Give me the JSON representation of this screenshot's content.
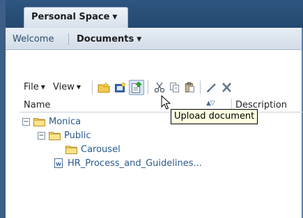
{
  "header": {
    "tab_label": "Personal Space"
  },
  "subnav": {
    "welcome_label": "Welcome",
    "documents_label": "Documents"
  },
  "toolbar": {
    "file_label": "File",
    "view_label": "View",
    "buttons": [
      {
        "icon": "new-folder-icon"
      },
      {
        "icon": "new-item-icon"
      },
      {
        "icon": "upload-document-icon"
      },
      {
        "icon": "cut-icon"
      },
      {
        "icon": "copy-icon"
      },
      {
        "icon": "paste-icon"
      },
      {
        "icon": "edit-icon"
      },
      {
        "icon": "delete-icon"
      }
    ]
  },
  "columns": {
    "name": "Name",
    "description": "Description"
  },
  "tree": [
    {
      "label": "Monica",
      "type": "folder",
      "expanded": true,
      "level": 0
    },
    {
      "label": "Public",
      "type": "folder",
      "expanded": true,
      "level": 1
    },
    {
      "label": "Carousel",
      "type": "folder",
      "expanded": false,
      "level": 2
    },
    {
      "label": "HR_Process_and_Guidelines...",
      "type": "document",
      "level": 1
    }
  ],
  "tooltip": {
    "text": "Upload document"
  },
  "colors": {
    "header_blue": "#2e5680",
    "tree_text": "#2a5a8f",
    "tooltip_bg": "#ffffe1"
  }
}
